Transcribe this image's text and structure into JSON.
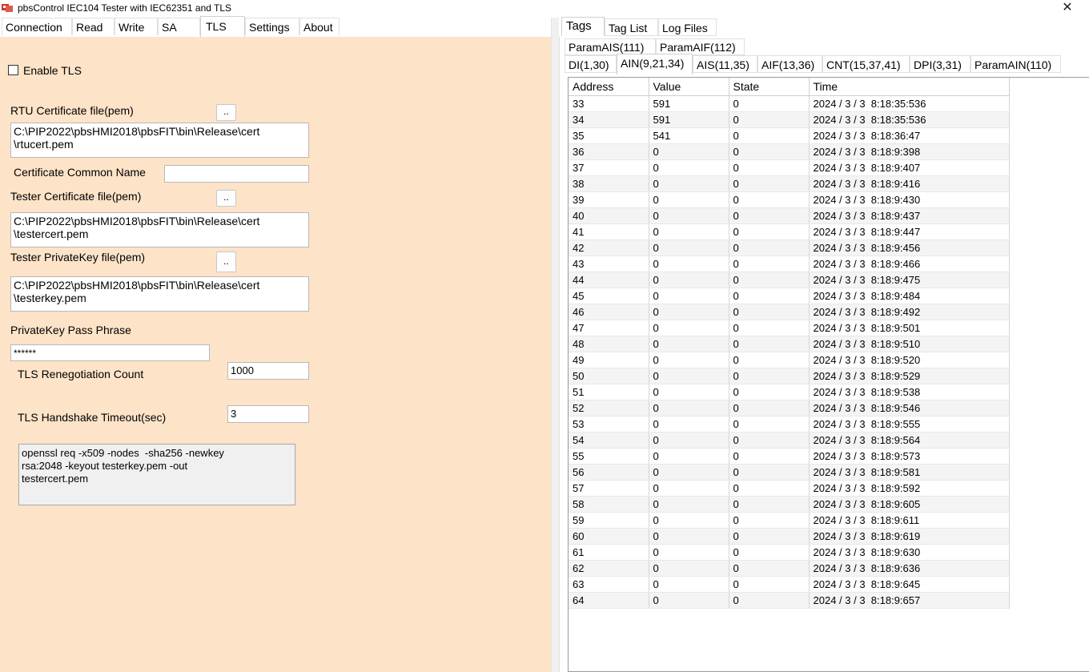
{
  "window": {
    "title": "pbsControl  IEC104 Tester with IEC62351  and TLS",
    "close_glyph": "✕"
  },
  "left_tabs": [
    {
      "label": "Connection"
    },
    {
      "label": "Read"
    },
    {
      "label": "Write"
    },
    {
      "label": "SA"
    },
    {
      "label": "TLS"
    },
    {
      "label": "Settings"
    },
    {
      "label": "About"
    }
  ],
  "tls": {
    "enable_label": "Enable TLS",
    "enable_checked": false,
    "rtu_cert_label": "RTU Certificate file(pem)",
    "rtu_cert_value": "C:\\PIP2022\\pbsHMI2018\\pbsFIT\\bin\\Release\\cert\n\\rtucert.pem",
    "common_name_label": "Certificate Common Name",
    "common_name_value": "",
    "tester_cert_label": "Tester Certificate file(pem)",
    "tester_cert_value": "C:\\PIP2022\\pbsHMI2018\\pbsFIT\\bin\\Release\\cert\n\\testercert.pem",
    "tester_key_label": "Tester PrivateKey file(pem)",
    "tester_key_value": "C:\\PIP2022\\pbsHMI2018\\pbsFIT\\bin\\Release\\cert\n\\testerkey.pem",
    "pass_label": "PrivateKey Pass Phrase",
    "pass_value": "******",
    "reneg_label": "TLS Renegotiation Count",
    "reneg_value": "1000",
    "handshake_label": "TLS Handshake Timeout(sec)",
    "handshake_value": "3",
    "browse_label": "..",
    "openssl_hint": "openssl req -x509 -nodes  -sha256 -newkey\nrsa:2048 -keyout testerkey.pem -out\ntestercert.pem"
  },
  "right_tabs": [
    {
      "label": "Tags"
    },
    {
      "label": "Tag List"
    },
    {
      "label": "Log Files"
    }
  ],
  "sub_tabs_row1": [
    {
      "label": "ParamAIS(111)"
    },
    {
      "label": "ParamAIF(112)"
    }
  ],
  "sub_tabs_row2": [
    {
      "label": "DI(1,30)"
    },
    {
      "label": "AIN(9,21,34)"
    },
    {
      "label": "AIS(11,35)"
    },
    {
      "label": "AIF(13,36)"
    },
    {
      "label": "CNT(15,37,41)"
    },
    {
      "label": "DPI(3,31)"
    },
    {
      "label": "ParamAIN(110)"
    }
  ],
  "grid": {
    "columns": [
      "Address",
      "Value",
      "State",
      "Time"
    ],
    "rows": [
      [
        "33",
        "591",
        "0",
        "2024 / 3 / 3  8:18:35:536"
      ],
      [
        "34",
        "591",
        "0",
        "2024 / 3 / 3  8:18:35:536"
      ],
      [
        "35",
        "541",
        "0",
        "2024 / 3 / 3  8:18:36:47"
      ],
      [
        "36",
        "0",
        "0",
        "2024 / 3 / 3  8:18:9:398"
      ],
      [
        "37",
        "0",
        "0",
        "2024 / 3 / 3  8:18:9:407"
      ],
      [
        "38",
        "0",
        "0",
        "2024 / 3 / 3  8:18:9:416"
      ],
      [
        "39",
        "0",
        "0",
        "2024 / 3 / 3  8:18:9:430"
      ],
      [
        "40",
        "0",
        "0",
        "2024 / 3 / 3  8:18:9:437"
      ],
      [
        "41",
        "0",
        "0",
        "2024 / 3 / 3  8:18:9:447"
      ],
      [
        "42",
        "0",
        "0",
        "2024 / 3 / 3  8:18:9:456"
      ],
      [
        "43",
        "0",
        "0",
        "2024 / 3 / 3  8:18:9:466"
      ],
      [
        "44",
        "0",
        "0",
        "2024 / 3 / 3  8:18:9:475"
      ],
      [
        "45",
        "0",
        "0",
        "2024 / 3 / 3  8:18:9:484"
      ],
      [
        "46",
        "0",
        "0",
        "2024 / 3 / 3  8:18:9:492"
      ],
      [
        "47",
        "0",
        "0",
        "2024 / 3 / 3  8:18:9:501"
      ],
      [
        "48",
        "0",
        "0",
        "2024 / 3 / 3  8:18:9:510"
      ],
      [
        "49",
        "0",
        "0",
        "2024 / 3 / 3  8:18:9:520"
      ],
      [
        "50",
        "0",
        "0",
        "2024 / 3 / 3  8:18:9:529"
      ],
      [
        "51",
        "0",
        "0",
        "2024 / 3 / 3  8:18:9:538"
      ],
      [
        "52",
        "0",
        "0",
        "2024 / 3 / 3  8:18:9:546"
      ],
      [
        "53",
        "0",
        "0",
        "2024 / 3 / 3  8:18:9:555"
      ],
      [
        "54",
        "0",
        "0",
        "2024 / 3 / 3  8:18:9:564"
      ],
      [
        "55",
        "0",
        "0",
        "2024 / 3 / 3  8:18:9:573"
      ],
      [
        "56",
        "0",
        "0",
        "2024 / 3 / 3  8:18:9:581"
      ],
      [
        "57",
        "0",
        "0",
        "2024 / 3 / 3  8:18:9:592"
      ],
      [
        "58",
        "0",
        "0",
        "2024 / 3 / 3  8:18:9:605"
      ],
      [
        "59",
        "0",
        "0",
        "2024 / 3 / 3  8:18:9:611"
      ],
      [
        "60",
        "0",
        "0",
        "2024 / 3 / 3  8:18:9:619"
      ],
      [
        "61",
        "0",
        "0",
        "2024 / 3 / 3  8:18:9:630"
      ],
      [
        "62",
        "0",
        "0",
        "2024 / 3 / 3  8:18:9:636"
      ],
      [
        "63",
        "0",
        "0",
        "2024 / 3 / 3  8:18:9:645"
      ],
      [
        "64",
        "0",
        "0",
        "2024 / 3 / 3  8:18:9:657"
      ]
    ]
  },
  "colors": {
    "panel_bg": "#fde3c8",
    "icon_red": "#c0392b"
  }
}
